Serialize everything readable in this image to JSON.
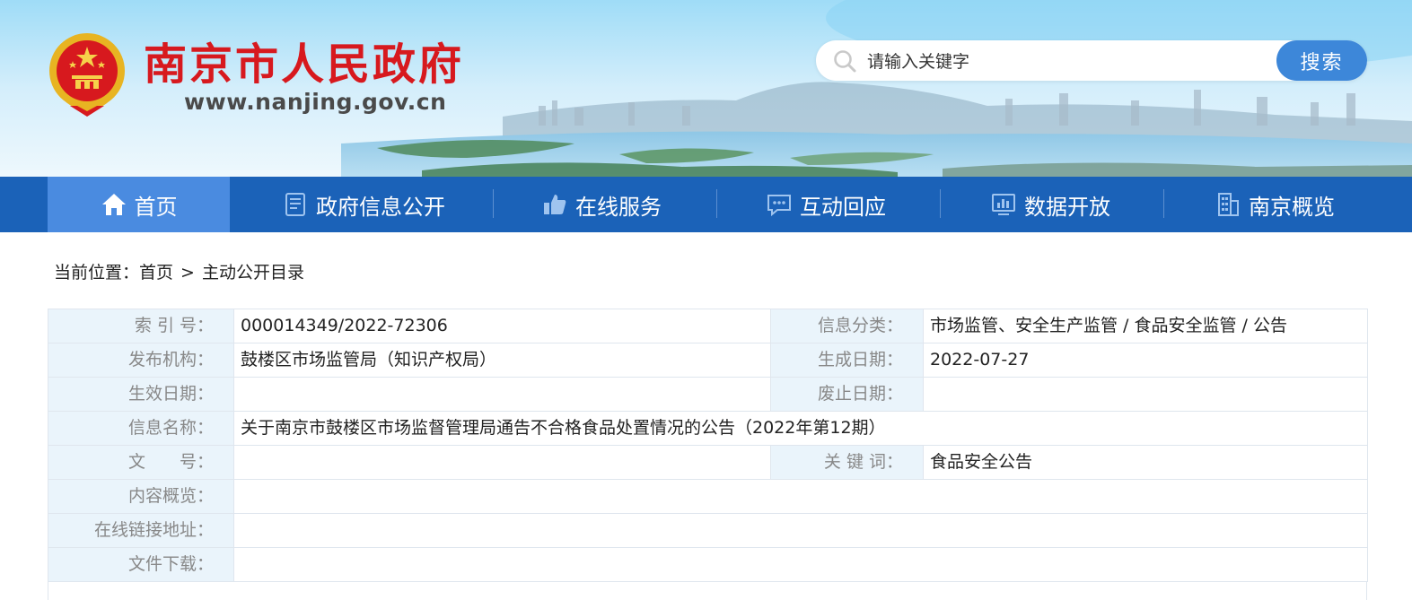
{
  "header": {
    "site_name": "南京市人民政府",
    "site_url": "www.nanjing.gov.cn",
    "emblem_icon": "national-emblem-icon"
  },
  "search": {
    "placeholder": "请输入关键字",
    "button_label": "搜索",
    "icon": "search-icon"
  },
  "nav": {
    "items": [
      {
        "label": "首页",
        "icon": "home-icon",
        "active": true
      },
      {
        "label": "政府信息公开",
        "icon": "document-icon",
        "active": false
      },
      {
        "label": "在线服务",
        "icon": "thumbs-up-icon",
        "active": false
      },
      {
        "label": "互动回应",
        "icon": "chat-icon",
        "active": false
      },
      {
        "label": "数据开放",
        "icon": "bar-chart-icon",
        "active": false
      },
      {
        "label": "南京概览",
        "icon": "building-icon",
        "active": false
      }
    ]
  },
  "breadcrumb": {
    "prefix": "当前位置：",
    "home": "首页",
    "separator": ">",
    "current": "主动公开目录"
  },
  "info": {
    "index_no_label": "索 引 号：",
    "index_no": "000014349/2022-72306",
    "category_label": "信息分类：",
    "category": "市场监管、安全生产监管 / 食品安全监管 / 公告",
    "publisher_label": "发布机构：",
    "publisher": "鼓楼区市场监管局（知识产权局）",
    "created_label": "生成日期：",
    "created": "2022-07-27",
    "effective_label": "生效日期：",
    "effective": "",
    "expiry_label": "废止日期：",
    "expiry": "",
    "title_label": "信息名称：",
    "title": "关于南京市鼓楼区市场监督管理局通告不合格食品处置情况的公告（2022年第12期）",
    "doc_no_label": "文　　号：",
    "doc_no": "",
    "keywords_label": "关 键 词：",
    "keywords": "食品安全公告",
    "summary_label": "内容概览：",
    "summary": "",
    "link_label": "在线链接地址：",
    "link": "",
    "download_label": "文件下载：",
    "download": ""
  },
  "colors": {
    "nav_bg": "#1b62b8",
    "nav_active": "#4a8be0",
    "title_red": "#d7191e",
    "search_button": "#3d87d9",
    "label_bg": "#eaf4fb"
  }
}
